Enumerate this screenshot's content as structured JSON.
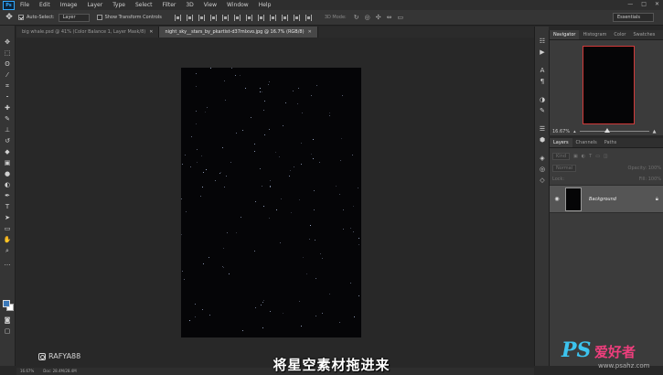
{
  "app": {
    "logo": "Ps",
    "menu": [
      "File",
      "Edit",
      "Image",
      "Layer",
      "Type",
      "Select",
      "Filter",
      "3D",
      "View",
      "Window",
      "Help"
    ],
    "window_controls": [
      "—",
      "□",
      "✕"
    ]
  },
  "options": {
    "auto_select_label": "Auto-Select:",
    "auto_select_checked": true,
    "auto_select_value": "Layer",
    "transform_label": "Show Transform Controls",
    "transform_checked": false,
    "mode_3d_label": "3D Mode:",
    "workspace": "Essentials"
  },
  "tabs": [
    {
      "label": "big whale.psd @ 41% (Color Balance 1, Layer Mask/8)",
      "active": false
    },
    {
      "label": "night_sky__stars_by_pkartist-d37mlxvo.jpg @ 16.7% (RGB/8)",
      "active": true
    }
  ],
  "colors": {
    "foreground": "#3a78b8",
    "background": "#ffffff",
    "accent": "#31a8ff",
    "nav_frame": "#d23a3a"
  },
  "navigator": {
    "tabs": [
      "Navigator",
      "Histogram",
      "Color",
      "Swatches"
    ],
    "zoom": "16.67%",
    "zoom_level": 0.4
  },
  "layers": {
    "tabs": [
      "Layers",
      "Channels",
      "Paths"
    ],
    "filter": "Kind",
    "blend_mode": "Normal",
    "opacity_label": "Opacity:",
    "opacity": "100%",
    "lock_label": "Lock:",
    "fill_label": "Fill:",
    "fill": "100%",
    "items": [
      {
        "name": "Background",
        "locked": true,
        "visible": true
      }
    ]
  },
  "status": {
    "zoom": "16.67%",
    "doc_size": "Doc: 28.4M/28.4M"
  },
  "overlay": {
    "instagram": "RAFYA88",
    "subtitle": "将星空素材拖进来",
    "brand_ps": "PS",
    "brand_cn": "爱好者",
    "brand_url": "www.psahz.com"
  }
}
